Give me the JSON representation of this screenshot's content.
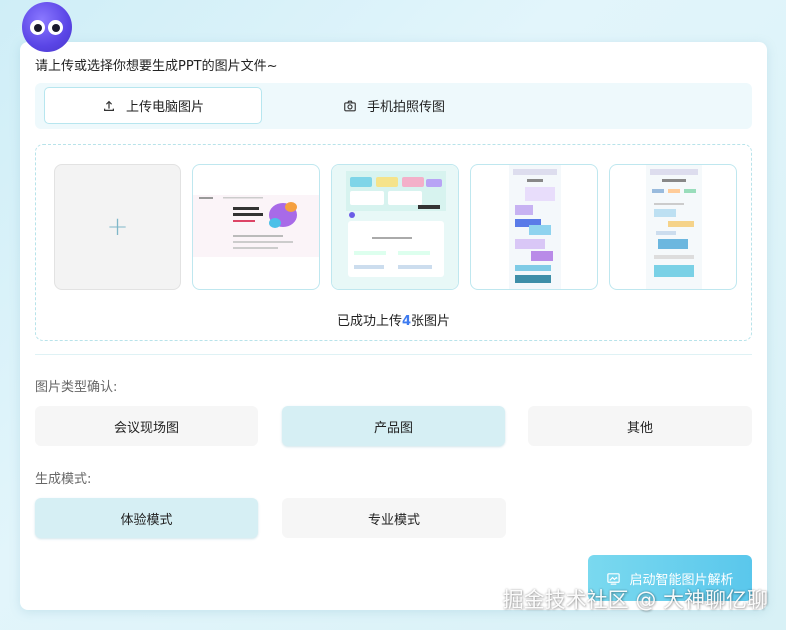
{
  "prompt": "请上传或选择你想要生成PPT的图片文件~",
  "tabs": [
    {
      "label": "上传电脑图片",
      "icon": "upload-icon",
      "active": true
    },
    {
      "label": "手机拍照传图",
      "icon": "camera-icon",
      "active": false
    }
  ],
  "upload": {
    "add_icon": "plus-icon",
    "status_prefix": "已成功上传",
    "count": "4",
    "status_suffix": "张图片"
  },
  "image_type": {
    "label": "图片类型确认:",
    "options": [
      "会议现场图",
      "产品图",
      "其他"
    ],
    "selected": "产品图"
  },
  "mode": {
    "label": "生成模式:",
    "options": [
      "体验模式",
      "专业模式"
    ],
    "selected": "体验模式"
  },
  "start_button": {
    "label": "启动智能图片解析",
    "icon": "image-scan-icon"
  },
  "watermark": "掘金技术社区 @ 大神聊亿聊",
  "colors": {
    "accent": "#5ac7ec",
    "selected_bg": "#d6eff4",
    "count": "#3e7bf0"
  }
}
